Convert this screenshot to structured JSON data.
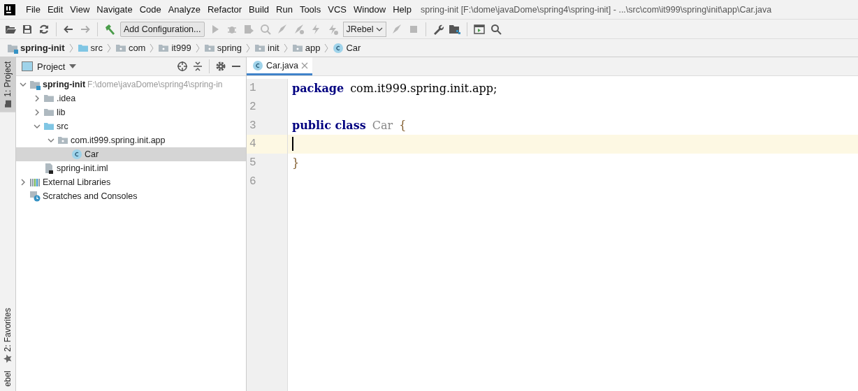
{
  "window": {
    "title": "spring-init [F:\\dome\\javaDome\\spring4\\spring-init] - ...\\src\\com\\it999\\spring\\init\\app\\Car.java"
  },
  "menu": [
    "File",
    "Edit",
    "View",
    "Navigate",
    "Code",
    "Analyze",
    "Refactor",
    "Build",
    "Run",
    "Tools",
    "VCS",
    "Window",
    "Help"
  ],
  "toolbar": {
    "configuration": "Add Configuration...",
    "run_actions_disabled": true,
    "jrebel": "JRebel"
  },
  "breadcrumbs": [
    {
      "kind": "module",
      "label": "spring-init"
    },
    {
      "kind": "source-folder",
      "label": "src"
    },
    {
      "kind": "package",
      "label": "com"
    },
    {
      "kind": "package",
      "label": "it999"
    },
    {
      "kind": "package",
      "label": "spring"
    },
    {
      "kind": "package",
      "label": "init"
    },
    {
      "kind": "package",
      "label": "app"
    },
    {
      "kind": "class",
      "label": "Car"
    }
  ],
  "side_stripe": [
    {
      "label": "1: Project",
      "selected": true,
      "kind": "project"
    },
    {
      "label": "2: Favorites",
      "selected": false,
      "kind": "favorites"
    },
    {
      "label": "ebel",
      "selected": false,
      "kind": "plain"
    }
  ],
  "project_panel": {
    "title": "Project",
    "tree": [
      {
        "kind": "module",
        "label": "spring-init",
        "path": "F:\\dome\\javaDome\\spring4\\spring-in",
        "expanded": true,
        "selected": false,
        "children": [
          {
            "kind": "folder",
            "label": ".idea",
            "expanded": false,
            "selected": false
          },
          {
            "kind": "folder",
            "label": "lib",
            "expanded": false,
            "selected": false
          },
          {
            "kind": "source-folder",
            "label": "src",
            "expanded": true,
            "selected": false,
            "children": [
              {
                "kind": "package",
                "label": "com.it999.spring.init.app",
                "expanded": true,
                "selected": false,
                "children": [
                  {
                    "kind": "class",
                    "label": "Car",
                    "selected": true
                  }
                ]
              }
            ]
          },
          {
            "kind": "iml",
            "label": "spring-init.iml",
            "selected": false
          }
        ]
      },
      {
        "kind": "libraries",
        "label": "External Libraries",
        "expanded": false,
        "selected": false
      },
      {
        "kind": "scratches",
        "label": "Scratches and Consoles",
        "selected": false
      }
    ]
  },
  "editor": {
    "tabs": [
      {
        "label": "Car.java",
        "selected": true
      }
    ],
    "lines": [
      {
        "number": "1",
        "current": false,
        "tokens": [
          {
            "kind": "keyword",
            "text": "package"
          },
          {
            "kind": "plain",
            "text": "com.it999.spring.init.app;"
          }
        ]
      },
      {
        "number": "2",
        "current": false
      },
      {
        "number": "3",
        "current": false,
        "tokens": [
          {
            "kind": "keyword",
            "text": "public class"
          },
          {
            "kind": "class-name",
            "text": "Car"
          },
          {
            "kind": "brace",
            "text": "{"
          }
        ]
      },
      {
        "number": "4",
        "current": true
      },
      {
        "number": "5",
        "current": false,
        "tokens": [
          {
            "kind": "brace",
            "text": "}"
          }
        ]
      },
      {
        "number": "6",
        "current": false
      }
    ]
  }
}
